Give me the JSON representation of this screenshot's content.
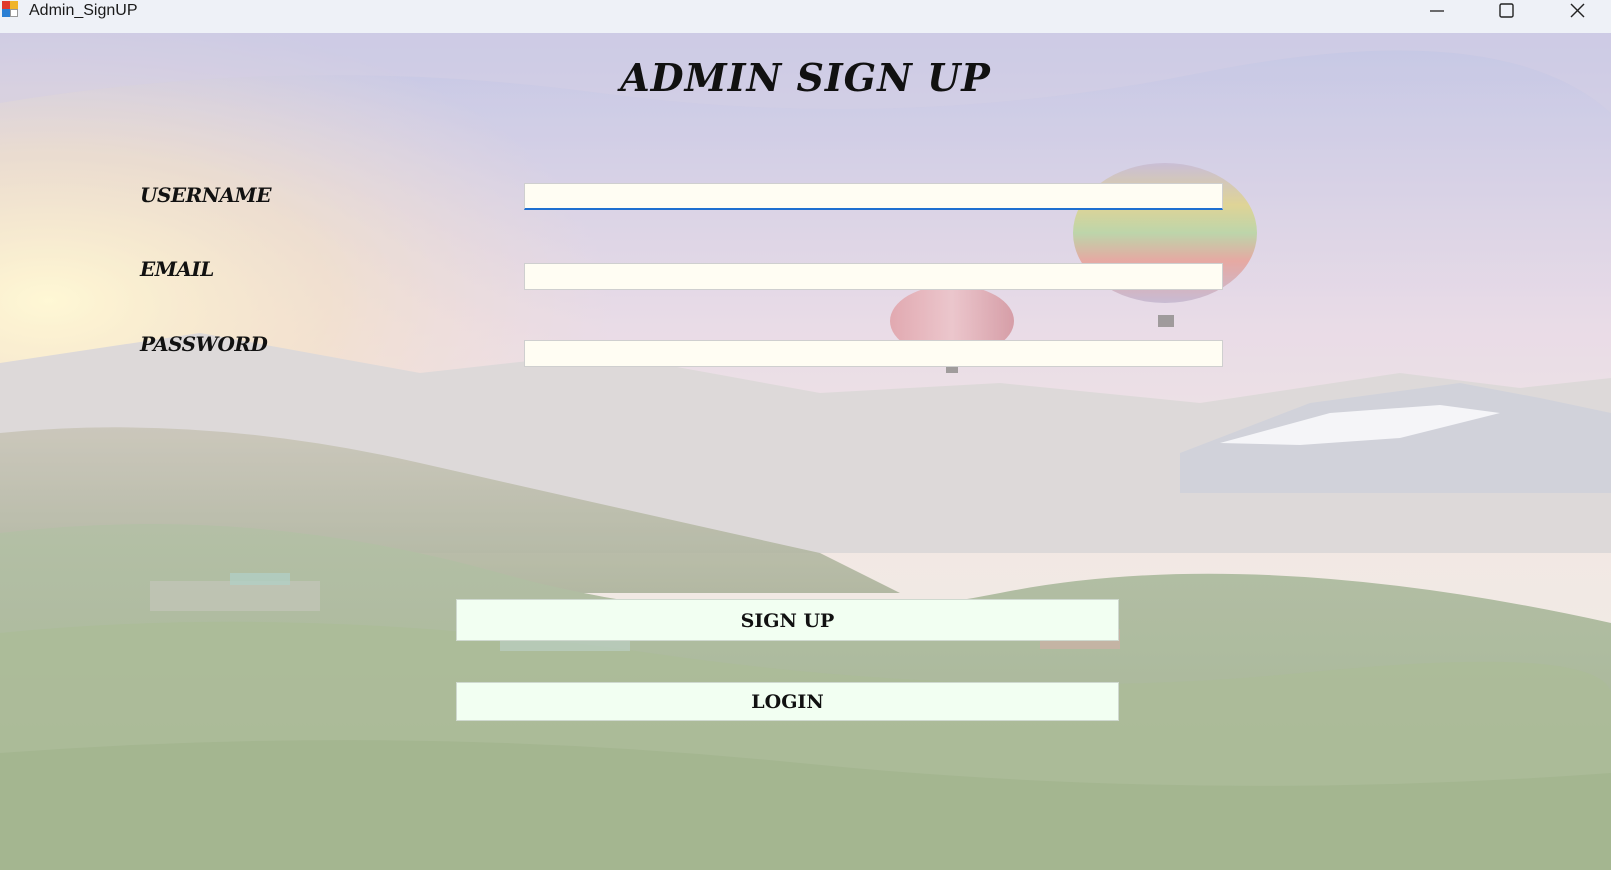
{
  "window": {
    "title": "Admin_SignUP",
    "controls": {
      "minimize": "minimize-icon",
      "maximize": "maximize-icon",
      "close": "close-icon"
    }
  },
  "form": {
    "heading": "ADMIN SIGN UP",
    "fields": {
      "username": {
        "label": "USERNAME",
        "value": ""
      },
      "email": {
        "label": "EMAIL",
        "value": ""
      },
      "password": {
        "label": "PASSWORD",
        "value": ""
      }
    },
    "buttons": {
      "signup": "SIGN UP",
      "login": "LOGIN"
    }
  },
  "colors": {
    "titlebar": "#eef1f7",
    "input_background": "#fffdf3",
    "focus_underline": "#1e6fd0",
    "button_background": "#f2fff2",
    "text": "#111111"
  }
}
